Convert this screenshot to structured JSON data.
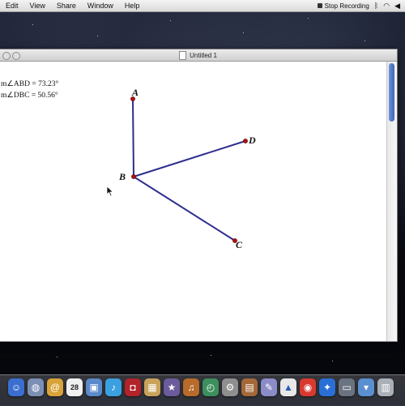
{
  "menubar": {
    "items": [
      "Edit",
      "View",
      "Share",
      "Window",
      "Help"
    ],
    "stop_recording": "Stop Recording"
  },
  "window": {
    "title": "Untitled 1"
  },
  "measurements": {
    "abd": "m∠ABD = 73.23°",
    "dbc": "m∠DBC = 50.56°"
  },
  "points": {
    "a": "A",
    "b": "B",
    "c": "C",
    "d": "D"
  },
  "dock": {
    "calendar_day": "28"
  },
  "colors": {
    "segment": "#2d2d8f",
    "point": "#b01010",
    "accent": "#3d66b8"
  }
}
